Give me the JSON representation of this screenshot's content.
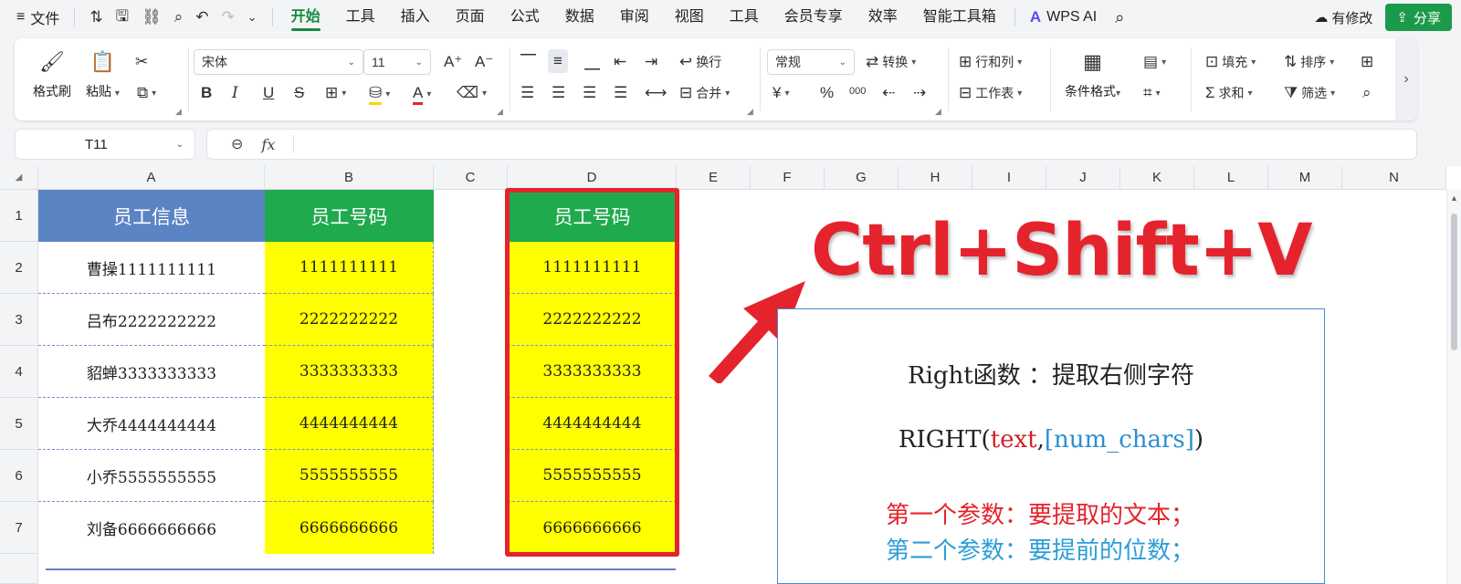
{
  "menubar": {
    "menu_icon": "≡",
    "file_label": "文件",
    "quick_access": [
      "sort-icon",
      "save-icon",
      "link-icon",
      "search-doc-icon",
      "undo-icon",
      "redo-icon",
      "more-icon"
    ],
    "tabs": [
      "开始",
      "工具",
      "插入",
      "页面",
      "公式",
      "数据",
      "审阅",
      "视图",
      "工具",
      "会员专享",
      "效率",
      "智能工具箱"
    ],
    "active_tab": "开始",
    "wps_ai_label": "WPS AI",
    "revise_label": "有修改",
    "share_label": "分享"
  },
  "ribbon": {
    "format_painter": "格式刷",
    "paste": "粘贴",
    "font_name": "宋体",
    "font_size": "11",
    "wrap_text": "换行",
    "merge": "合并",
    "number_format": "常规",
    "convert": "转换",
    "row_col": "行和列",
    "worksheet": "工作表",
    "cond_format": "条件格式",
    "fill": "填充",
    "sort": "排序",
    "sum": "求和",
    "filter": "筛选",
    "icons": {
      "bold": "B",
      "italic": "I",
      "underline": "U",
      "strike": "S",
      "currency": "¥",
      "percent": "%",
      "thousands": "000",
      "increase_font": "A⁺",
      "decrease_font": "A⁻"
    }
  },
  "formula_bar": {
    "cell_ref": "T11",
    "formula": ""
  },
  "columns": [
    "A",
    "B",
    "C",
    "D",
    "E",
    "F",
    "G",
    "H",
    "I",
    "J",
    "K",
    "L",
    "M",
    "N"
  ],
  "rows": [
    "1",
    "2",
    "3",
    "4",
    "5",
    "6",
    "7"
  ],
  "table": {
    "header_a": "员工信息",
    "header_b": "员工号码",
    "header_d": "员工号码",
    "col_a": [
      "曹操1111111111",
      "吕布2222222222",
      "貂蝉3333333333",
      "大乔4444444444",
      "小乔5555555555",
      "刘备6666666666"
    ],
    "col_b": [
      "1111111111",
      "2222222222",
      "3333333333",
      "4444444444",
      "5555555555",
      "6666666666"
    ],
    "col_d": [
      "1111111111",
      "2222222222",
      "3333333333",
      "4444444444",
      "5555555555",
      "6666666666"
    ]
  },
  "annotation": {
    "shortcut": "Ctrl+Shift+V",
    "line1": "Right函数 ：提取右侧字符",
    "line2_prefix": "RIGHT(",
    "line2_text": "text",
    "line2_comma": ",",
    "line2_num": "[num_chars]",
    "line2_suffix": ")",
    "line3": "第一个参数：要提取的文本；",
    "line4": "第二个参数：要提前的位数；"
  },
  "colors": {
    "accent_green": "#1c9a4c",
    "header_blue": "#5b84c4",
    "header_green": "#1faa4e",
    "highlight_yellow": "#ffff00",
    "annotation_red": "#e5232d",
    "param_blue": "#2b9ed8"
  }
}
